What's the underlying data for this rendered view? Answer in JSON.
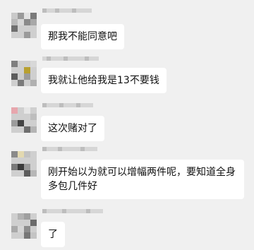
{
  "chat": {
    "messages": [
      {
        "text": "那我不能同意吧",
        "avatar_colors": [
          "#c9c9c9",
          "#9a9a9a",
          "#e2e2e2",
          "#7a7a7a",
          "#b9b9b9",
          "#d7d7d7",
          "#8a8a8a",
          "#a8a8a8",
          "#6f6f6f"
        ]
      },
      {
        "text": "我就让他给我是13不要钱",
        "avatar_colors": [
          "#7f7f7f",
          "#cfcfcf",
          "#b8a030",
          "#d8d8d8",
          "#5c5c5c",
          "#cccccc",
          "#9b9b9b",
          "#b0b0b0",
          "#7b7b7b"
        ]
      },
      {
        "text": "这次赌对了",
        "avatar_colors": [
          "#e7a6ad",
          "#cfcfcf",
          "#e6e6e6",
          "#bdbdbd",
          "#444444",
          "#d0d0d0",
          "#9c9c9c",
          "#6e6e6e",
          "#b4b4b4"
        ]
      },
      {
        "text": "刚开始以为就可以增幅两件呢，要知道全身\n多包几件好",
        "avatar_colors": [
          "#8a8a8a",
          "#e3d9b0",
          "#c2c2c2",
          "#cfcfcf",
          "#3b3b3b",
          "#9a9a9a",
          "#7a7a7a",
          "#5d5d5d",
          "#b7b7b7"
        ]
      },
      {
        "text": "了",
        "avatar_colors": [
          "#cfcfcf",
          "#b2b2b2",
          "#9f9f9f",
          "#6c6c6c",
          "#d5d5d5",
          "#8d8d8d",
          "#a9a9a9",
          "#777777",
          "#c4c4c4"
        ]
      }
    ]
  }
}
